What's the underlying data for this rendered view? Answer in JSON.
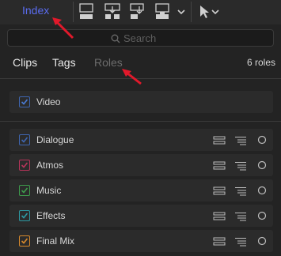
{
  "toolbar": {
    "index_tab": "Index",
    "buttons": [
      "connect-clip-icon",
      "insert-clip-icon",
      "append-clip-icon",
      "overwrite-clip-icon",
      "select-tool-icon"
    ]
  },
  "search": {
    "placeholder": "Search",
    "value": ""
  },
  "subtabs": {
    "clips": "Clips",
    "tags": "Tags",
    "roles": "Roles"
  },
  "roles_count": "6 roles",
  "video_role": {
    "label": "Video",
    "color": "#3f66b0"
  },
  "audio_roles": [
    {
      "label": "Dialogue",
      "color": "#3f66b0"
    },
    {
      "label": "Atmos",
      "color": "#b8345a"
    },
    {
      "label": "Music",
      "color": "#3e9a4c"
    },
    {
      "label": "Effects",
      "color": "#2d9aa3"
    },
    {
      "label": "Final Mix",
      "color": "#d88a2c"
    }
  ],
  "accent": "#5a6cf0",
  "annotation_color": "#e1192b"
}
